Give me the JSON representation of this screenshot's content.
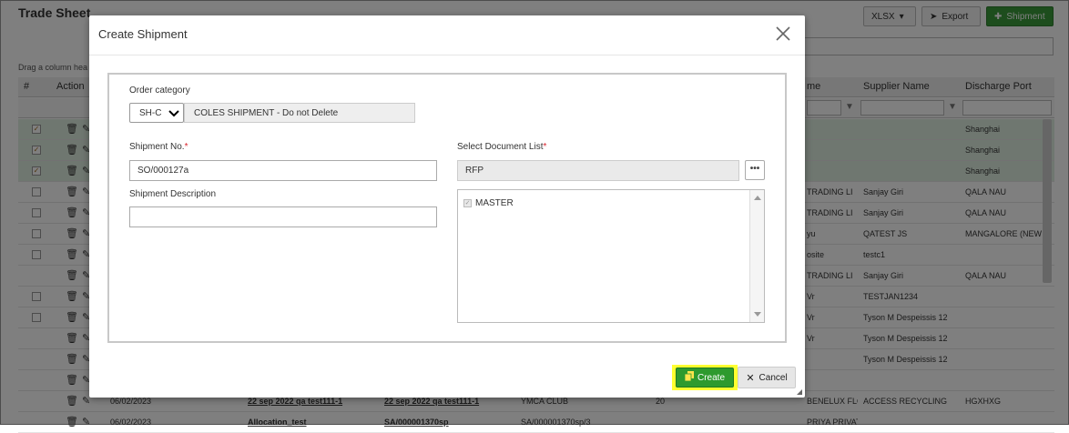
{
  "background": {
    "title": "Trade Sheet",
    "toolbar": {
      "format": "XLSX",
      "export_label": "Export",
      "shipment_label": "Shipment"
    },
    "drag_hint": "Drag a column hea",
    "columns": {
      "num": "#",
      "action": "Action",
      "name_fragment": "me",
      "supplier": "Supplier Name",
      "port": "Discharge Port"
    },
    "rows": [
      {
        "checked": true,
        "name": "",
        "supplier": "",
        "port": "Shanghai"
      },
      {
        "checked": true,
        "name": "",
        "supplier": "",
        "port": "Shanghai"
      },
      {
        "checked": true,
        "name": "",
        "supplier": "",
        "port": "Shanghai"
      },
      {
        "checked": false,
        "name": "TRADING LI",
        "supplier": "Sanjay Giri",
        "port": "QALA NAU"
      },
      {
        "checked": false,
        "name": "TRADING LI",
        "supplier": "Sanjay Giri",
        "port": "QALA NAU"
      },
      {
        "checked": false,
        "name": "yu",
        "supplier": "QATEST JS",
        "port": "MANGALORE (NEW I"
      },
      {
        "checked": false,
        "name": "osite",
        "supplier": "testc1",
        "port": ""
      },
      {
        "checked": null,
        "name": "TRADING LI",
        "supplier": "Sanjay Giri",
        "port": "QALA NAU"
      },
      {
        "checked": false,
        "name": "Vr",
        "supplier": "TESTJAN1234",
        "port": ""
      },
      {
        "checked": false,
        "name": "Vr",
        "supplier": "Tyson M Despeissis 12",
        "port": ""
      },
      {
        "checked": null,
        "name": "Vr",
        "supplier": "Tyson M Despeissis 12",
        "port": ""
      },
      {
        "checked": null,
        "name": "",
        "supplier": "Tyson M Despeissis 12",
        "port": ""
      },
      {
        "checked": null,
        "name": "",
        "supplier": "",
        "port": ""
      },
      {
        "checked": null,
        "name": "BENELUX FLOWERS & ...",
        "supplier": "ACCESS RECYCLING",
        "port": "HGXHXG"
      },
      {
        "checked": null,
        "name": "PRIYA PRIVATE LTD",
        "supplier": "",
        "port": ""
      }
    ],
    "bottom_rows": [
      {
        "date": "06/02/2023",
        "ref1": "22 sep 2022 qa test111-1",
        "ref2": "22 sep 2022 qa test111-1",
        "ref3": "YMCA CLUB",
        "qty": "20"
      },
      {
        "date": "06/02/2023",
        "ref1": "Allocation_test",
        "ref2": "SA/000001370sp",
        "ref3": "SA/000001370sp/3",
        "qty": ""
      }
    ]
  },
  "modal": {
    "title": "Create Shipment",
    "order_category_label": "Order category",
    "order_category_code": "SH-C",
    "order_category_name": "COLES SHIPMENT - Do not Delete",
    "shipment_no_label": "Shipment No.",
    "shipment_no_value": "SO/000127a",
    "shipment_desc_label": "Shipment Description",
    "shipment_desc_value": "",
    "doc_list_label": "Select Document List",
    "doc_list_value": "RFP",
    "doc_items": [
      "MASTER"
    ],
    "required_mark": "*",
    "create_label": "Create",
    "cancel_label": "Cancel"
  },
  "colors": {
    "accent_green": "#2e9a2e",
    "highlight": "#ffff30",
    "required": "#d9232d"
  }
}
